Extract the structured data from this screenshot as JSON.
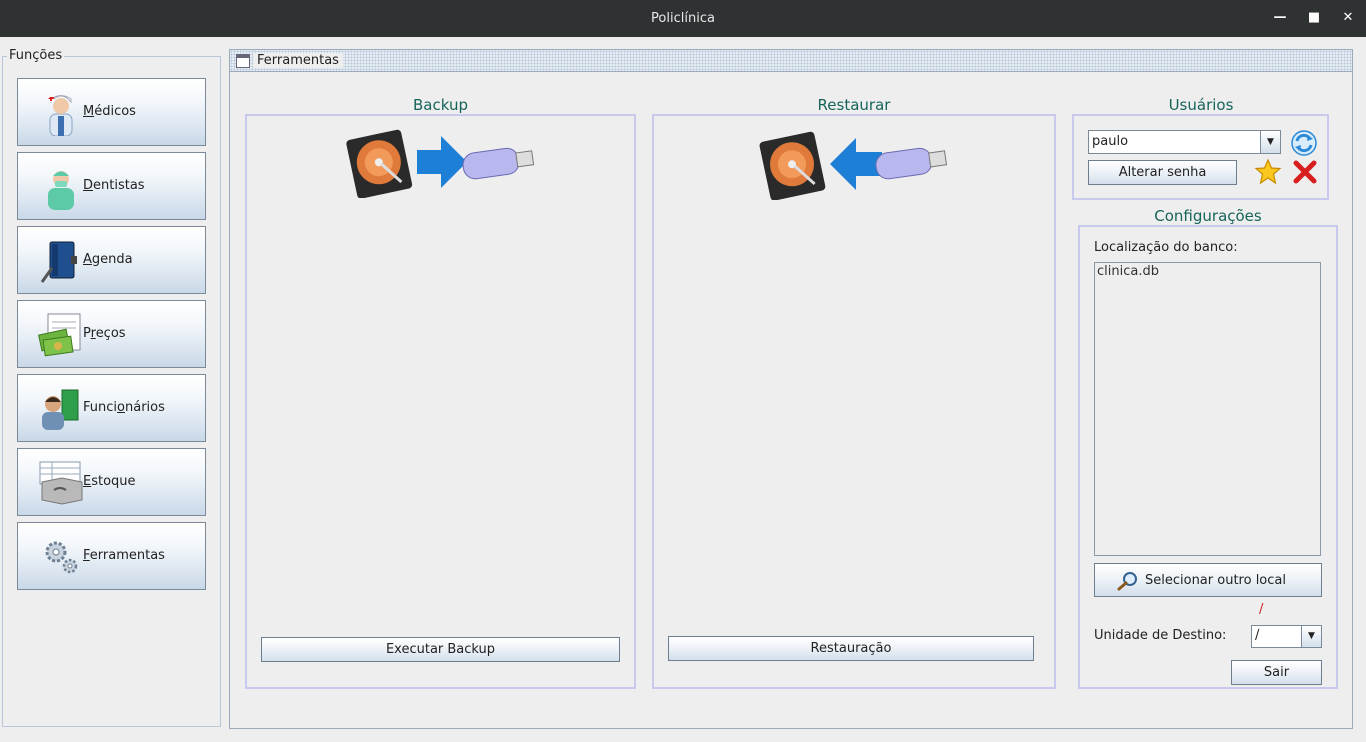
{
  "window": {
    "title": "Policlínica"
  },
  "sidebar": {
    "legend": "Funções",
    "items": [
      {
        "label": "Médicos",
        "icon": "doctor-icon",
        "mnemonic": "M"
      },
      {
        "label": "Dentistas",
        "icon": "dentist-icon",
        "mnemonic": "D"
      },
      {
        "label": "Agenda",
        "icon": "agenda-book-icon",
        "mnemonic": "A"
      },
      {
        "label": "Preços",
        "icon": "money-icon",
        "mnemonic": "r"
      },
      {
        "label": "Funcionários",
        "icon": "employees-icon",
        "mnemonic": "o"
      },
      {
        "label": "Estoque",
        "icon": "stock-box-icon",
        "mnemonic": "E"
      },
      {
        "label": "Ferramentas",
        "icon": "gears-icon",
        "mnemonic": "F"
      }
    ]
  },
  "frame": {
    "title": "Ferramentas"
  },
  "backup": {
    "title": "Backup",
    "button": "Executar Backup"
  },
  "restore": {
    "title": "Restaurar",
    "button": "Restauração"
  },
  "users": {
    "title": "Usuários",
    "selected_user": "paulo",
    "change_password": "Alterar senha"
  },
  "config": {
    "title": "Configurações",
    "db_location_label": "Localização do banco:",
    "db_location_value": "clinica.db",
    "select_location_button": "Selecionar outro local",
    "marker": "/",
    "destination_label": "Unidade de Destino:",
    "destination_value": "/",
    "exit_button": "Sair"
  },
  "colors": {
    "section_title": "#17645a",
    "box_border": "#c9c9ef",
    "titlebar": "#2f3233"
  }
}
